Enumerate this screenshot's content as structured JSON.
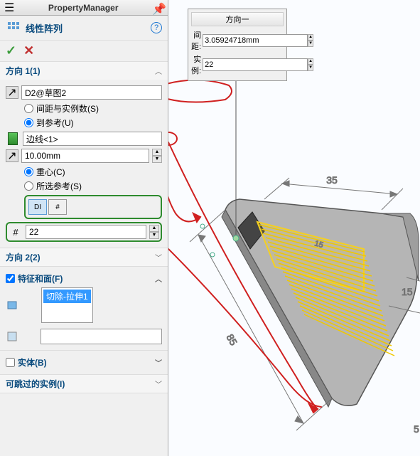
{
  "header": {
    "title": "PropertyManager"
  },
  "feature": {
    "name": "线性阵列",
    "help": "?"
  },
  "direction1": {
    "title": "方向 1(1)",
    "reference_field": "D2@草图2",
    "radio_spacing": "间距与实例数(S)",
    "radio_upto": "到参考(U)",
    "edge_field": "边线<1>",
    "offset_field": "10.00mm",
    "radio_centroid": "重心(C)",
    "radio_selected": "所选参考(S)",
    "count_field": "22",
    "pattern_icon1": "DI",
    "pattern_icon2": "#"
  },
  "direction2": {
    "title": "方向 2(2)"
  },
  "features_section": {
    "title": "特征和面(F)",
    "items": [
      "切除-拉伸1"
    ]
  },
  "solids_section": {
    "title": "实体(B)"
  },
  "skip_section": {
    "title": "可跳过的实例(I)"
  },
  "floating": {
    "title": "方向一",
    "spacing_label": "间距:",
    "spacing_value": "3.05924718mm",
    "instances_label": "实例:",
    "instances_value": "22"
  },
  "dimensions": {
    "dim35": "35",
    "dim85": "85",
    "dim15": "15",
    "dim5": "5",
    "dim_small": "15"
  }
}
